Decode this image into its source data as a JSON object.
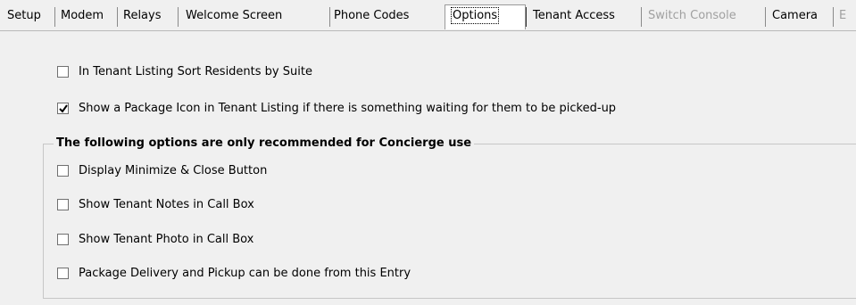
{
  "tabs": [
    {
      "label": "Setup",
      "state": "normal"
    },
    {
      "label": "Modem",
      "state": "normal"
    },
    {
      "label": "Relays",
      "state": "normal"
    },
    {
      "label": "Welcome Screen",
      "state": "normal"
    },
    {
      "label": "Phone Codes",
      "state": "normal"
    },
    {
      "label": "Options",
      "state": "active"
    },
    {
      "label": "Tenant Access",
      "state": "normal"
    },
    {
      "label": "Switch Console",
      "state": "disabled"
    },
    {
      "label": "Camera",
      "state": "normal"
    },
    {
      "label": "E",
      "state": "disabled"
    }
  ],
  "options": {
    "sort_by_suite": {
      "label": "In Tenant Listing Sort Residents by Suite",
      "checked": false
    },
    "package_icon": {
      "label": "Show a Package Icon in Tenant Listing if there is something waiting for them to be picked-up",
      "checked": true
    }
  },
  "concierge_group": {
    "title": "The following options are only recommended for Concierge use",
    "items": [
      {
        "label": "Display Minimize & Close Button",
        "checked": false
      },
      {
        "label": "Show Tenant Notes in Call Box",
        "checked": false
      },
      {
        "label": "Show Tenant Photo in Call Box",
        "checked": false
      },
      {
        "label": "Package Delivery and Pickup can be done from this Entry",
        "checked": false
      }
    ]
  }
}
